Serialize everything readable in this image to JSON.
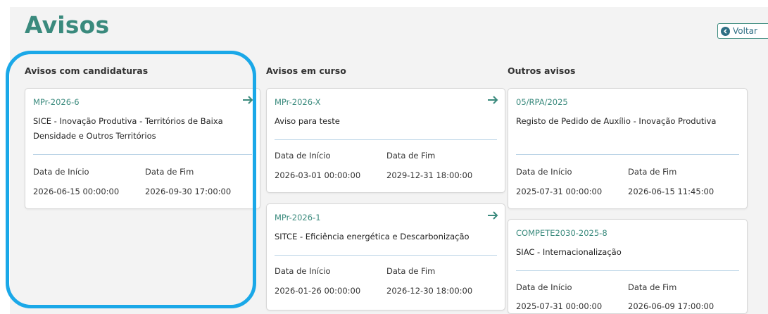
{
  "page": {
    "title": "Avisos",
    "back_label": "Voltar"
  },
  "columns": [
    {
      "heading": "Avisos com candidaturas",
      "cards": [
        {
          "code": "MPr-2026-6",
          "title": "SICE - Inovação Produtiva - Territórios de Baixa Densidade e Outros Territórios",
          "start_label": "Data de Início",
          "end_label": "Data de Fim",
          "start": "2026-06-15 00:00:00",
          "end": "2026-09-30 17:00:00"
        }
      ]
    },
    {
      "heading": "Avisos em curso",
      "cards": [
        {
          "code": "MPr-2026-X",
          "title": "Aviso para teste",
          "start_label": "Data de Início",
          "end_label": "Data de Fim",
          "start": "2026-03-01 00:00:00",
          "end": "2029-12-31 18:00:00"
        },
        {
          "code": "MPr-2026-1",
          "title": "SITCE - Eficiência energética e Descarbonização",
          "start_label": "Data de Início",
          "end_label": "Data de Fim",
          "start": "2026-01-26 00:00:00",
          "end": "2026-12-30 18:00:00"
        }
      ]
    },
    {
      "heading": "Outros avisos",
      "cards": [
        {
          "code": "05/RPA/2025",
          "title": "Registo de Pedido de Auxílio - Inovação Produtiva",
          "start_label": "Data de Início",
          "end_label": "Data de Fim",
          "start": "2025-07-31 00:00:00",
          "end": "2026-06-15 11:45:00"
        },
        {
          "code": "COMPETE2030-2025-8",
          "title": "SIAC - Internacionalização",
          "start_label": "Data de Início",
          "end_label": "Data de Fim",
          "start": "2025-07-31 00:00:00",
          "end": "2026-06-09 17:00:00"
        }
      ]
    }
  ],
  "colors": {
    "accent": "#3a8a7d",
    "highlight": "#1aa8e8",
    "divider": "#b9d3e6"
  }
}
